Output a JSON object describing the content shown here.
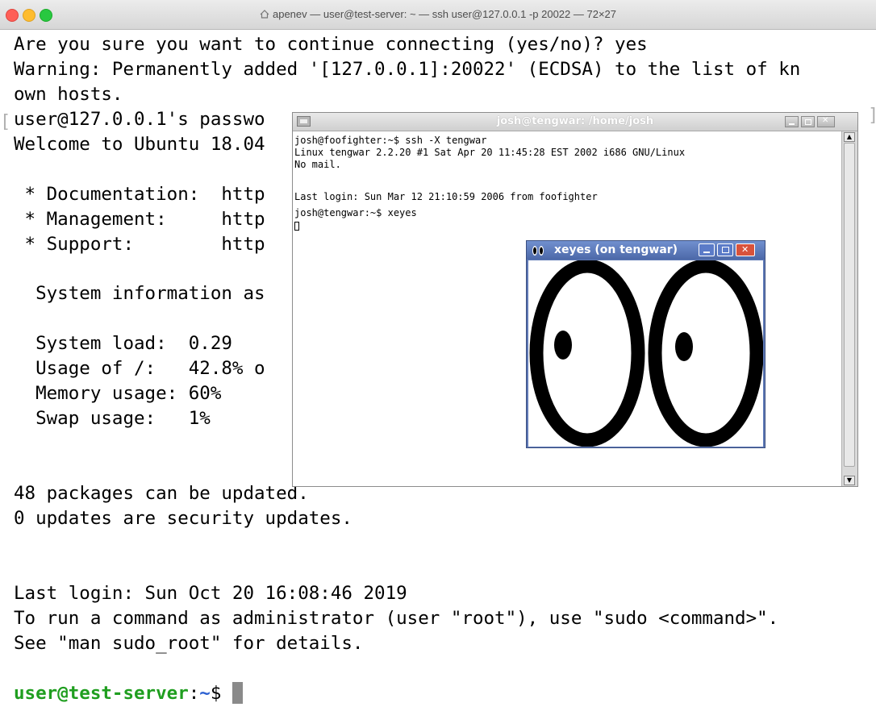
{
  "mac_window": {
    "title": "apenev — user@test-server: ~ — ssh user@127.0.0.1 -p 20022 — 72×27"
  },
  "terminal": {
    "lines": [
      "Are you sure you want to continue connecting (yes/no)? yes",
      "Warning: Permanently added '[127.0.0.1]:20022' (ECDSA) to the list of kn",
      "own hosts.",
      "user@127.0.0.1's passwo",
      "Welcome to Ubuntu 18.04",
      "",
      " * Documentation:  http",
      " * Management:     http",
      " * Support:        http",
      "",
      "  System information as",
      "",
      "  System load:  0.29",
      "  Usage of /:   42.8% o",
      "  Memory usage: 60%",
      "  Swap usage:   1%",
      "",
      "",
      "48 packages can be updated.",
      "0 updates are security updates.",
      "",
      "",
      "Last login: Sun Oct 20 16:08:46 2019",
      "To run a command as administrator (user \"root\"), use \"sudo <command>\".",
      "See \"man sudo_root\" for details."
    ],
    "prompt_user": "user@test-server",
    "prompt_sep": ":",
    "prompt_path": "~",
    "prompt_symbol": "$ "
  },
  "xterm_window": {
    "title": "josh@tengwar: /home/josh",
    "lines": [
      "josh@foofighter:~$ ssh -X tengwar",
      "Linux tengwar 2.2.20 #1 Sat Apr 20 11:45:28 EST 2002 i686 GNU/Linux",
      "No mail.",
      "",
      "Last login: Sun Mar 12 21:10:59 2006 from foofighter",
      "josh@tengwar:~$ xeyes"
    ]
  },
  "xeyes_window": {
    "title": "xeyes (on tengwar)"
  },
  "colors": {
    "prompt_user": "#1f9e1f",
    "prompt_path": "#2a5fd1",
    "xeyes_titlebar": "#5e79b6"
  }
}
